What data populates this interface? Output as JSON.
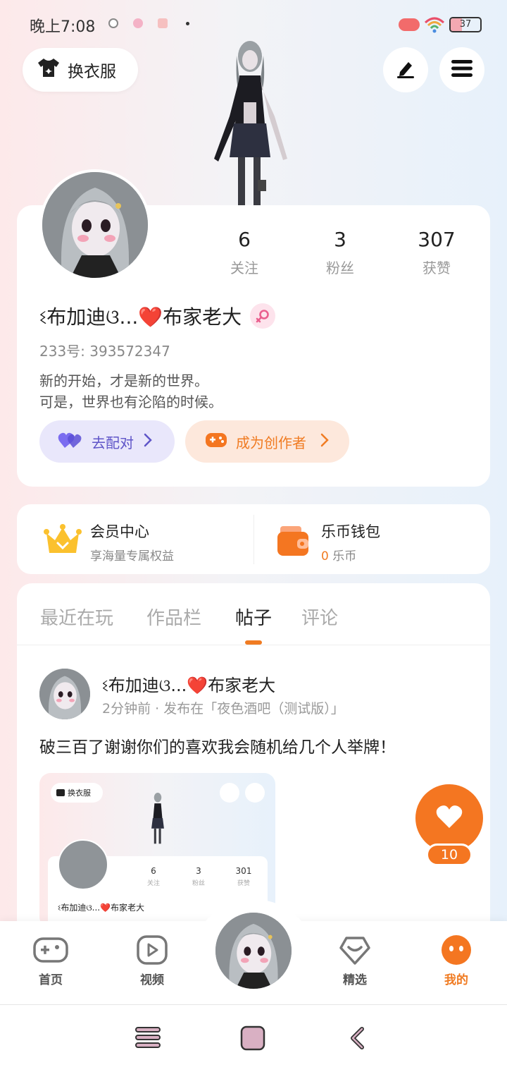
{
  "status_bar": {
    "time": "晚上7:08",
    "battery": "37",
    "battery_level": 0.37
  },
  "top": {
    "outfit_label": "换衣服",
    "edit_icon": "pen-icon",
    "menu_icon": "hamburger-icon"
  },
  "profile": {
    "stats": [
      {
        "value": "6",
        "label": "关注"
      },
      {
        "value": "3",
        "label": "粉丝"
      },
      {
        "value": "307",
        "label": "获赞"
      }
    ],
    "username": "ଽ布加迪ଓ...❤️布家老大",
    "gender": "female",
    "id_text": "233号: 393572347",
    "bio_line1": "新的开始，才是新的世界。",
    "bio_line2": "可是，世界也有沦陷的时候。",
    "match_label": "去配对",
    "creator_label": "成为创作者",
    "colors": {
      "match": "#5f55c8",
      "creator": "#f07b22"
    }
  },
  "member": {
    "vip_title": "会员中心",
    "vip_sub": "享海量专属权益",
    "wallet_title": "乐币钱包",
    "wallet_amount": "0",
    "wallet_unit": "乐币"
  },
  "tabs": {
    "items": [
      "最近在玩",
      "作品栏",
      "帖子",
      "评论"
    ],
    "active": "帖子"
  },
  "post": {
    "author": "ଽ布加迪ଓ...❤️布家老大",
    "meta": "2分钟前 · 发布在「夜色酒吧（测试版）」",
    "text": "破三百了谢谢你们的喜欢我会随机给几个人举牌！",
    "thumb": {
      "outfit_label": "换衣服",
      "stats": [
        {
          "value": "6",
          "label": "关注"
        },
        {
          "value": "3",
          "label": "粉丝"
        },
        {
          "value": "301",
          "label": "获赞"
        }
      ],
      "username": "ଽ布加迪ଓ...❤️布家老大"
    }
  },
  "like": {
    "count": "10",
    "color": "#f47621"
  },
  "nav": {
    "items": [
      {
        "label": "首页",
        "icon": "gamepad-icon"
      },
      {
        "label": "视频",
        "icon": "play-icon"
      },
      {
        "label": "精选",
        "icon": "heart-shield-icon"
      },
      {
        "label": "我的",
        "icon": "face-icon"
      }
    ],
    "active": "我的",
    "accent": "#f07b22"
  }
}
